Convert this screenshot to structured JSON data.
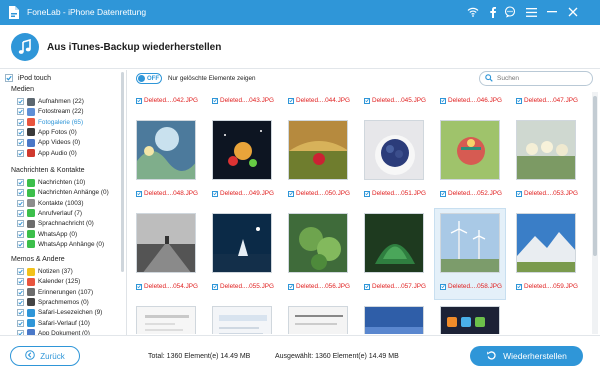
{
  "window": {
    "title": "FoneLab - iPhone Datenrettung"
  },
  "header": {
    "title": "Aus iTunes-Backup wiederherstellen"
  },
  "sidebar": {
    "device": "iPod touch",
    "sections": [
      {
        "title": "Medien",
        "items": [
          {
            "label": "Aufnahmen (22)",
            "icon": "camera-icon",
            "color": "#5c6770"
          },
          {
            "label": "Fotostream (22)",
            "icon": "photostream-icon",
            "color": "#5e8fd6"
          },
          {
            "label": "Fotogalerie (65)",
            "icon": "photo-gallery-icon",
            "color": "#e9553f",
            "active": true
          },
          {
            "label": "App Fotos (0)",
            "icon": "app-photos-icon",
            "color": "#3a3a3a"
          },
          {
            "label": "App Videos (0)",
            "icon": "app-videos-icon",
            "color": "#4a78c8"
          },
          {
            "label": "App Audio (0)",
            "icon": "app-audio-icon",
            "color": "#d0392e"
          }
        ]
      },
      {
        "title": "Nachrichten & Kontakte",
        "items": [
          {
            "label": "Nachrichten (10)",
            "icon": "messages-icon",
            "color": "#3cbf4b"
          },
          {
            "label": "Nachrichten Anhänge (0)",
            "icon": "message-attachments-icon",
            "color": "#3cbf4b"
          },
          {
            "label": "Kontakte (1003)",
            "icon": "contacts-icon",
            "color": "#8d8d8d"
          },
          {
            "label": "Anrufverlauf (7)",
            "icon": "call-history-icon",
            "color": "#3cbf4b"
          },
          {
            "label": "Sprachnachricht (0)",
            "icon": "voicemail-icon",
            "color": "#6d6d6d"
          },
          {
            "label": "WhatsApp (0)",
            "icon": "whatsapp-icon",
            "color": "#3cbf4b"
          },
          {
            "label": "WhatsApp Anhänge (0)",
            "icon": "whatsapp-attachments-icon",
            "color": "#3cbf4b"
          }
        ]
      },
      {
        "title": "Memos & Andere",
        "items": [
          {
            "label": "Notizen (37)",
            "icon": "notes-icon",
            "color": "#f2c21b"
          },
          {
            "label": "Kalender (125)",
            "icon": "calendar-icon",
            "color": "#e9553f"
          },
          {
            "label": "Erinnerungen (107)",
            "icon": "reminders-icon",
            "color": "#6d6d6d"
          },
          {
            "label": "Sprachmemos (0)",
            "icon": "voice-memos-icon",
            "color": "#444444"
          },
          {
            "label": "Safari-Lesezeichen (9)",
            "icon": "safari-bookmarks-icon",
            "color": "#2f96d8"
          },
          {
            "label": "Safari-Verlauf (10)",
            "icon": "safari-history-icon",
            "color": "#2f96d8"
          },
          {
            "label": "App Dokument (0)",
            "icon": "app-document-icon",
            "color": "#4a78c8"
          }
        ]
      }
    ]
  },
  "toolbar": {
    "toggle_state": "OFF",
    "toggle_text": "Nur gelöschte Elemente zeigen",
    "search_placeholder": "Suchen"
  },
  "grid": {
    "labels_row0": [
      "Deleted....042.JPG",
      "Deleted....043.JPG",
      "Deleted....044.JPG",
      "Deleted....045.JPG",
      "Deleted....046.JPG",
      "Deleted....047.JPG"
    ],
    "labels_row1": [
      "Deleted....048.JPG",
      "Deleted....049.JPG",
      "Deleted....050.JPG",
      "Deleted....051.JPG",
      "Deleted....052.JPG",
      "Deleted....053.JPG"
    ],
    "labels_row2": [
      "Deleted....054.JPG",
      "Deleted....055.JPG",
      "Deleted....056.JPG",
      "Deleted....057.JPG",
      "Deleted....058.JPG",
      "Deleted....059.JPG"
    ],
    "selected_index": 16,
    "partial_text": [
      "iPhone",
      "Mobile",
      "Rate",
      "Data",
      "Information",
      "to Go"
    ]
  },
  "footer": {
    "back_label": "Zurück",
    "total": "Total: 1360 Element(e) 14.49 MB",
    "selected": "Ausgewählt: 1360 Element(e) 14.49 MB",
    "restore_label": "Wiederherstellen"
  },
  "colors": {
    "accent": "#2f96d8",
    "deleted": "#e02020"
  }
}
